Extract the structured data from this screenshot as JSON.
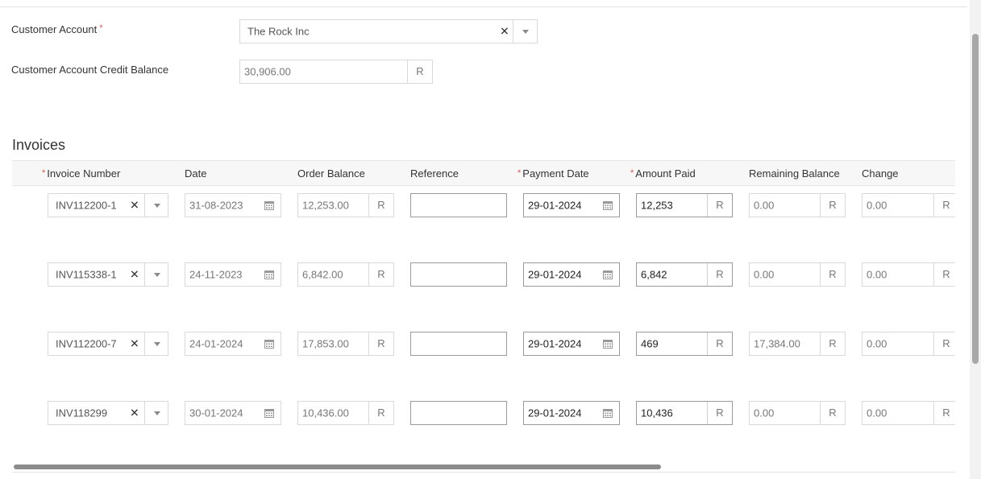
{
  "form": {
    "customer_account_label": "Customer Account",
    "required_mark": "*",
    "customer_account_value": "The Rock Inc",
    "credit_balance_label": "Customer Account Credit Balance",
    "credit_balance_value": "30,906.00",
    "currency": "R"
  },
  "invoices": {
    "title": "Invoices",
    "headers": {
      "invoice_number": "Invoice Number",
      "date": "Date",
      "order_balance": "Order Balance",
      "reference": "Reference",
      "payment_date": "Payment Date",
      "amount_paid": "Amount Paid",
      "remaining_balance": "Remaining Balance",
      "change": "Change"
    },
    "rows": [
      {
        "invoice": "INV112200-1",
        "date": "31-08-2023",
        "order_balance": "12,253.00",
        "reference": "",
        "payment_date": "29-01-2024",
        "amount_paid": "12,253",
        "remaining": "0.00",
        "change": "0.00"
      },
      {
        "invoice": "INV115338-1",
        "date": "24-11-2023",
        "order_balance": "6,842.00",
        "reference": "",
        "payment_date": "29-01-2024",
        "amount_paid": "6,842",
        "remaining": "0.00",
        "change": "0.00"
      },
      {
        "invoice": "INV112200-7",
        "date": "24-01-2024",
        "order_balance": "17,853.00",
        "reference": "",
        "payment_date": "29-01-2024",
        "amount_paid": "469",
        "remaining": "17,384.00",
        "change": "0.00"
      },
      {
        "invoice": "INV118299",
        "date": "30-01-2024",
        "order_balance": "10,436.00",
        "reference": "",
        "payment_date": "29-01-2024",
        "amount_paid": "10,436",
        "remaining": "0.00",
        "change": "0.00"
      }
    ]
  },
  "icons": {
    "clear": "close-icon",
    "dropdown": "chevron-down-icon",
    "calendar": "calendar-icon"
  },
  "colors": {
    "required": "#d9534f",
    "header_bg": "#f7f7f7",
    "border": "#d9d9d9"
  }
}
